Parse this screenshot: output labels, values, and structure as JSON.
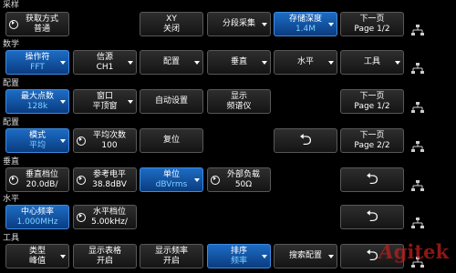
{
  "sections": {
    "sample": "采样",
    "math": "数学",
    "config1": "配置",
    "config2": "配置",
    "vertical": "垂直",
    "horizontal": "水平",
    "tools": "工具"
  },
  "row_sample": {
    "acquire": {
      "l1": "获取方式",
      "l2": "普通"
    },
    "xy": {
      "l1": "XY",
      "l2": "关闭"
    },
    "segment": {
      "l1": "分段采集"
    },
    "depth": {
      "l1": "存储深度",
      "l2": "1.4M"
    },
    "next": {
      "l1": "下一页",
      "l2": "Page 1/2"
    }
  },
  "row_math": {
    "operator": {
      "l1": "操作符",
      "l2": "FFT"
    },
    "source": {
      "l1": "信源",
      "l2": "CH1"
    },
    "config": {
      "l1": "配置"
    },
    "vertical": {
      "l1": "垂直"
    },
    "horizontal": {
      "l1": "水平"
    },
    "tools": {
      "l1": "工具"
    }
  },
  "row_config1": {
    "max_points": {
      "l1": "最大点数",
      "l2": "128k"
    },
    "window": {
      "l1": "窗口",
      "l2": "平顶窗"
    },
    "auto_set": {
      "l1": "自动设置"
    },
    "show_spectrum": {
      "l1": "显示",
      "l2": "频谱仪"
    },
    "next": {
      "l1": "下一页",
      "l2": "Page 1/2"
    }
  },
  "row_config2": {
    "mode": {
      "l1": "模式",
      "l2": "平均"
    },
    "avg_count": {
      "l1": "平均次数",
      "l2": "100"
    },
    "reset": {
      "l1": "复位"
    },
    "back": "⮌",
    "next": {
      "l1": "下一页",
      "l2": "Page 2/2"
    }
  },
  "row_vertical": {
    "vscale": {
      "l1": "垂直档位",
      "l2": "20.0dB/"
    },
    "ref_level": {
      "l1": "参考电平",
      "l2": "38.8dBV"
    },
    "unit": {
      "l1": "单位",
      "l2": "dBVrms"
    },
    "ext_load": {
      "l1": "外部负载",
      "l2": "50Ω"
    },
    "back": "⮌"
  },
  "row_horizontal": {
    "center_freq": {
      "l1": "中心频率",
      "l2": "1.000MHz"
    },
    "hscale": {
      "l1": "水平档位",
      "l2": "5.00kHz/"
    },
    "back": "⮌"
  },
  "row_tools": {
    "type": {
      "l1": "类型",
      "l2": "峰值"
    },
    "show_table": {
      "l1": "显示表格",
      "l2": "开启"
    },
    "show_freq": {
      "l1": "显示频率",
      "l2": "开启"
    },
    "sort": {
      "l1": "排序",
      "l2": "频率"
    },
    "search_config": {
      "l1": "搜索配置"
    },
    "back": "⮌"
  },
  "watermark": {
    "a": "A",
    "rest": "gitek"
  },
  "colors": {
    "highlight": "#1d6cc4",
    "highlight_text": "#7fd0ff",
    "button": "#2e2e2e"
  }
}
